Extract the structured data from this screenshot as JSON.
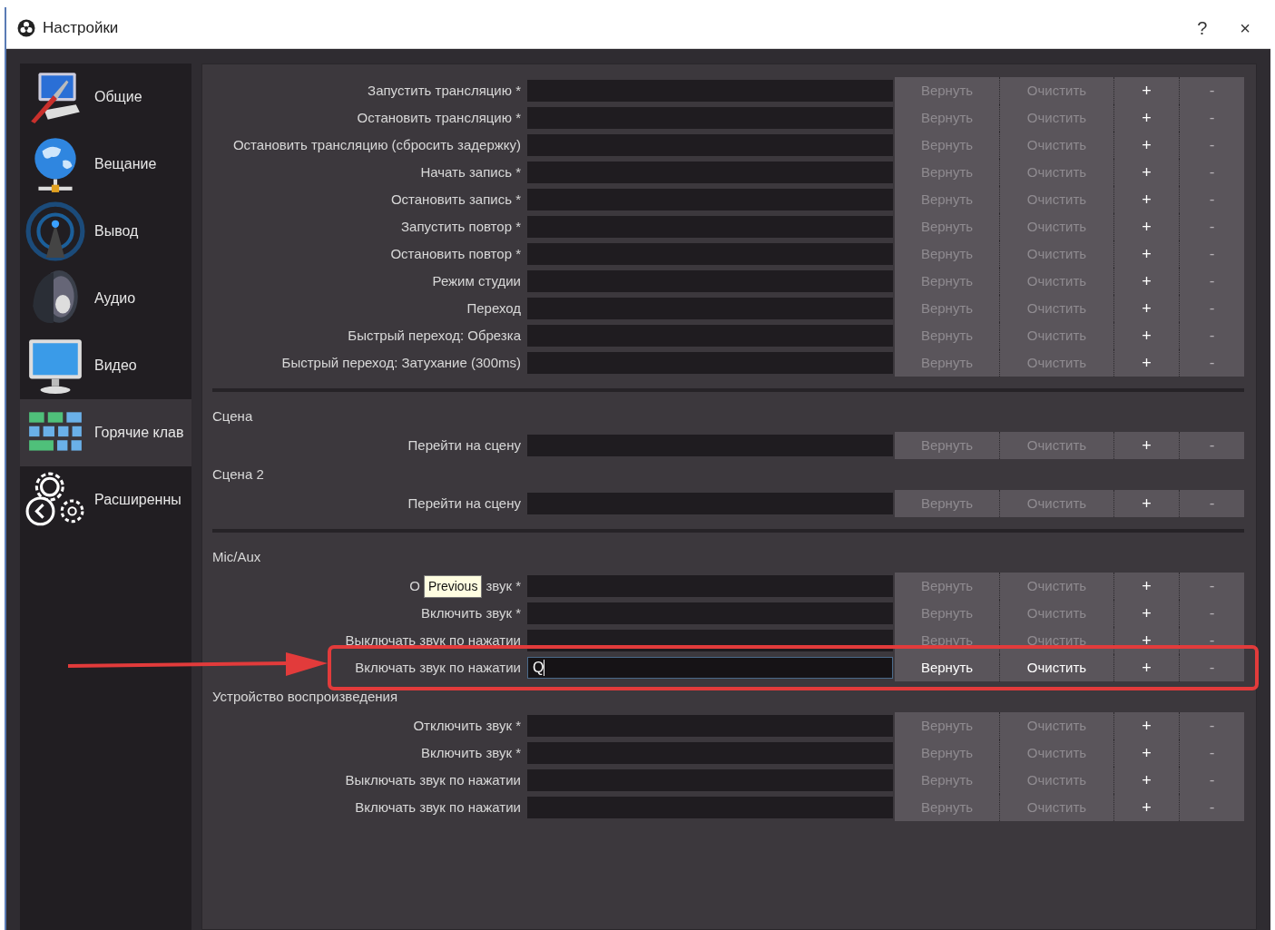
{
  "window": {
    "title": "Настройки",
    "help": "?",
    "close": "×"
  },
  "sidebar": {
    "items": [
      {
        "label": "Общие",
        "selected": false
      },
      {
        "label": "Вещание",
        "selected": false
      },
      {
        "label": "Вывод",
        "selected": false
      },
      {
        "label": "Аудио",
        "selected": false
      },
      {
        "label": "Видео",
        "selected": false
      },
      {
        "label": "Горячие клав",
        "selected": true
      },
      {
        "label": "Расширенны",
        "selected": false
      }
    ]
  },
  "groups": [
    {
      "divider_after": true,
      "rows": [
        {
          "label": "Запустить трансляцию *",
          "buttons": [
            "Вернуть",
            "Очистить",
            "+",
            "-"
          ],
          "buttons_enabled": false,
          "highlighted": false
        },
        {
          "label": "Остановить трансляцию *",
          "buttons": [
            "Вернуть",
            "Очистить",
            "+",
            "-"
          ],
          "buttons_enabled": false,
          "highlighted": false
        },
        {
          "label": "Остановить трансляцию (сбросить задержку)",
          "buttons": [
            "Вернуть",
            "Очистить",
            "+",
            "-"
          ],
          "buttons_enabled": false,
          "highlighted": false
        },
        {
          "label": "Начать запись *",
          "buttons": [
            "Вернуть",
            "Очистить",
            "+",
            "-"
          ],
          "buttons_enabled": false,
          "highlighted": false
        },
        {
          "label": "Остановить запись *",
          "buttons": [
            "Вернуть",
            "Очистить",
            "+",
            "-"
          ],
          "buttons_enabled": false,
          "highlighted": false
        },
        {
          "label": "Запустить повтор *",
          "buttons": [
            "Вернуть",
            "Очистить",
            "+",
            "-"
          ],
          "buttons_enabled": false,
          "highlighted": false
        },
        {
          "label": "Остановить повтор *",
          "buttons": [
            "Вернуть",
            "Очистить",
            "+",
            "-"
          ],
          "buttons_enabled": false,
          "highlighted": false
        },
        {
          "label": "Режим студии",
          "buttons": [
            "Вернуть",
            "Очистить",
            "+",
            "-"
          ],
          "buttons_enabled": false,
          "highlighted": false
        },
        {
          "label": "Переход",
          "buttons": [
            "Вернуть",
            "Очистить",
            "+",
            "-"
          ],
          "buttons_enabled": false,
          "highlighted": false
        },
        {
          "label": "Быстрый переход: Обрезка",
          "buttons": [
            "Вернуть",
            "Очистить",
            "+",
            "-"
          ],
          "buttons_enabled": false,
          "highlighted": false
        },
        {
          "label": "Быстрый переход: Затухание (300ms)",
          "buttons": [
            "Вернуть",
            "Очистить",
            "+",
            "-"
          ],
          "buttons_enabled": false,
          "highlighted": false
        }
      ]
    },
    {
      "title": "Сцена",
      "divider_after": false,
      "rows": [
        {
          "label": "Перейти на сцену",
          "buttons": [
            "Вернуть",
            "Очистить",
            "+",
            "-"
          ],
          "buttons_enabled": false,
          "highlighted": false
        }
      ]
    },
    {
      "title": "Сцена 2",
      "divider_after": true,
      "rows": [
        {
          "label": "Перейти на сцену",
          "buttons": [
            "Вернуть",
            "Очистить",
            "+",
            "-"
          ],
          "buttons_enabled": false,
          "highlighted": false
        }
      ]
    },
    {
      "title": "Mic/Aux",
      "divider_after": false,
      "rows": [
        {
          "label_parts": [
            "О",
            "звук *"
          ],
          "tooltip": "Previous",
          "buttons": [
            "Вернуть",
            "Очистить",
            "+",
            "-"
          ],
          "buttons_enabled": false,
          "highlighted": false
        },
        {
          "label": "Включить звук *",
          "buttons": [
            "Вернуть",
            "Очистить",
            "+",
            "-"
          ],
          "buttons_enabled": false,
          "highlighted": false
        },
        {
          "label": "Выключать звук по нажатии",
          "buttons": [
            "Вернуть",
            "Очистить",
            "+",
            "-"
          ],
          "buttons_enabled": false,
          "highlighted": false
        },
        {
          "label": "Включать звук по нажатии",
          "value": "Q",
          "buttons": [
            "Вернуть",
            "Очистить",
            "+",
            "-"
          ],
          "buttons_enabled": true,
          "highlighted": true
        }
      ]
    },
    {
      "title": "Устройство воспроизведения",
      "divider_after": false,
      "rows": [
        {
          "label": "Отключить звук *",
          "buttons": [
            "Вернуть",
            "Очистить",
            "+",
            "-"
          ],
          "buttons_enabled": false,
          "highlighted": false
        },
        {
          "label": "Включить звук *",
          "buttons": [
            "Вернуть",
            "Очистить",
            "+",
            "-"
          ],
          "buttons_enabled": false,
          "highlighted": false
        },
        {
          "label": "Выключать звук по нажатии",
          "buttons": [
            "Вернуть",
            "Очистить",
            "+",
            "-"
          ],
          "buttons_enabled": false,
          "highlighted": false
        },
        {
          "label": "Включать звук по нажатии",
          "buttons": [
            "Вернуть",
            "Очистить",
            "+",
            "-"
          ],
          "buttons_enabled": false,
          "highlighted": false
        }
      ]
    }
  ]
}
